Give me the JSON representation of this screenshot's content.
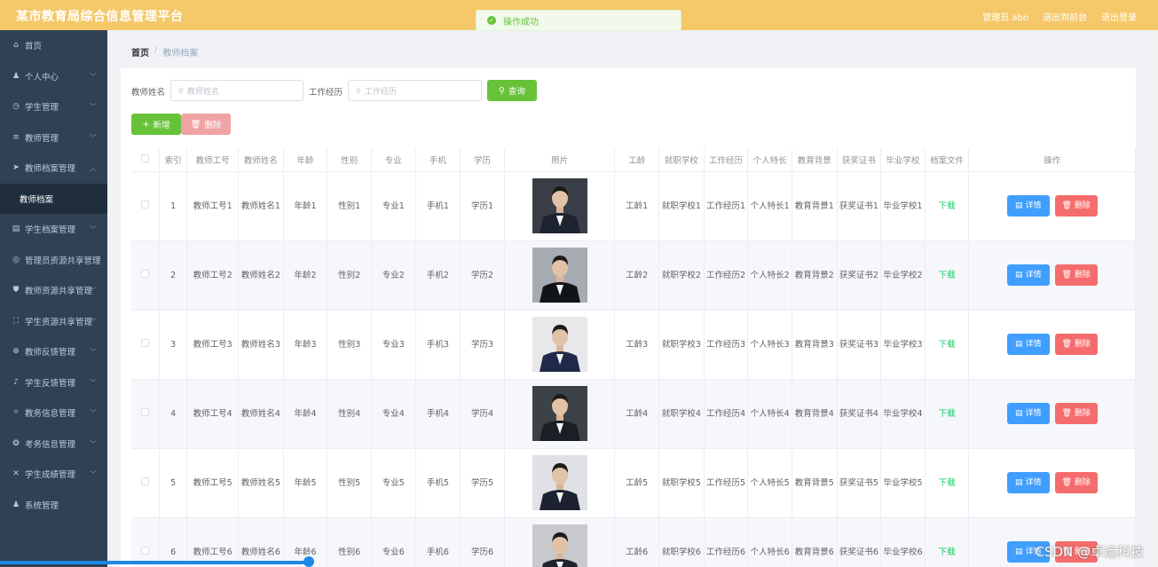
{
  "header": {
    "title": "某市教育局综合信息管理平台",
    "admin_label": "管理员 abo",
    "exit_home": "退出到前台",
    "logout": "退出登录"
  },
  "toast": {
    "message": "操作成功"
  },
  "sidebar": {
    "items": [
      {
        "label": "首页",
        "icon": "home-icon"
      },
      {
        "label": "个人中心",
        "icon": "user-icon"
      },
      {
        "label": "学生管理",
        "icon": "clock-icon"
      },
      {
        "label": "教师管理",
        "icon": "list-icon"
      },
      {
        "label": "教师档案管理",
        "icon": "send-icon"
      },
      {
        "label": "教师档案",
        "icon": ""
      },
      {
        "label": "学生档案管理",
        "icon": "document-icon"
      },
      {
        "label": "管理员资源共享管理",
        "icon": "target-icon"
      },
      {
        "label": "教师资源共享管理",
        "icon": "shield-icon"
      },
      {
        "label": "学生资源共享管理",
        "icon": "frame-icon"
      },
      {
        "label": "教师反馈管理",
        "icon": "globe-icon"
      },
      {
        "label": "学生反馈管理",
        "icon": "mic-icon"
      },
      {
        "label": "教务信息管理",
        "icon": "compass-icon"
      },
      {
        "label": "考务信息管理",
        "icon": "aperture-icon"
      },
      {
        "label": "学生成绩管理",
        "icon": "grid-icon"
      },
      {
        "label": "系统管理",
        "icon": "user-icon"
      }
    ]
  },
  "breadcrumb": {
    "home": "首页",
    "sep": "/",
    "current": "教师档案"
  },
  "search": {
    "name_label": "教师姓名",
    "name_placeholder": "教师姓名",
    "exp_label": "工作经历",
    "exp_placeholder": "工作经历",
    "query_label": "查询"
  },
  "toolbar": {
    "add_label": "新增",
    "delete_label": "删除"
  },
  "table": {
    "headers": [
      "索引",
      "教师工号",
      "教师姓名",
      "年龄",
      "性别",
      "专业",
      "手机",
      "学历",
      "照片",
      "工龄",
      "就职学校",
      "工作经历",
      "个人特长",
      "教育背景",
      "获奖证书",
      "毕业学校",
      "档案文件",
      "操作"
    ],
    "download_label": "下载",
    "detail_label": "详情",
    "remove_label": "删除",
    "rows": [
      {
        "idx": "1",
        "no": "教师工号1",
        "name": "教师姓名1",
        "age": "年龄1",
        "sex": "性别1",
        "major": "专业1",
        "phone": "手机1",
        "edu": "学历1",
        "years": "工龄1",
        "school": "就职学校1",
        "exp": "工作经历1",
        "skill": "个人特长1",
        "bg": "教育背景1",
        "cert": "获奖证书1",
        "grad": "毕业学校1"
      },
      {
        "idx": "2",
        "no": "教师工号2",
        "name": "教师姓名2",
        "age": "年龄2",
        "sex": "性别2",
        "major": "专业2",
        "phone": "手机2",
        "edu": "学历2",
        "years": "工龄2",
        "school": "就职学校2",
        "exp": "工作经历2",
        "skill": "个人特长2",
        "bg": "教育背景2",
        "cert": "获奖证书2",
        "grad": "毕业学校2"
      },
      {
        "idx": "3",
        "no": "教师工号3",
        "name": "教师姓名3",
        "age": "年龄3",
        "sex": "性别3",
        "major": "专业3",
        "phone": "手机3",
        "edu": "学历3",
        "years": "工龄3",
        "school": "就职学校3",
        "exp": "工作经历3",
        "skill": "个人特长3",
        "bg": "教育背景3",
        "cert": "获奖证书3",
        "grad": "毕业学校3"
      },
      {
        "idx": "4",
        "no": "教师工号4",
        "name": "教师姓名4",
        "age": "年龄4",
        "sex": "性别4",
        "major": "专业4",
        "phone": "手机4",
        "edu": "学历4",
        "years": "工龄4",
        "school": "就职学校4",
        "exp": "工作经历4",
        "skill": "个人特长4",
        "bg": "教育背景4",
        "cert": "获奖证书4",
        "grad": "毕业学校4"
      },
      {
        "idx": "5",
        "no": "教师工号5",
        "name": "教师姓名5",
        "age": "年龄5",
        "sex": "性别5",
        "major": "专业5",
        "phone": "手机5",
        "edu": "学历5",
        "years": "工龄5",
        "school": "就职学校5",
        "exp": "工作经历5",
        "skill": "个人特长5",
        "bg": "教育背景5",
        "cert": "获奖证书5",
        "grad": "毕业学校5"
      },
      {
        "idx": "6",
        "no": "教师工号6",
        "name": "教师姓名6",
        "age": "年龄6",
        "sex": "性别6",
        "major": "专业6",
        "phone": "手机6",
        "edu": "学历6",
        "years": "工龄6",
        "school": "就职学校6",
        "exp": "工作经历6",
        "skill": "个人特长6",
        "bg": "教育背景6",
        "cert": "获奖证书6",
        "grad": "毕业学校6"
      }
    ]
  },
  "watermark": "CSDN @卓远科技",
  "colors": {
    "header": "#f5c86a",
    "sidebar": "#304156",
    "success": "#67c23a",
    "primary": "#409eff",
    "danger": "#f56c6c"
  }
}
